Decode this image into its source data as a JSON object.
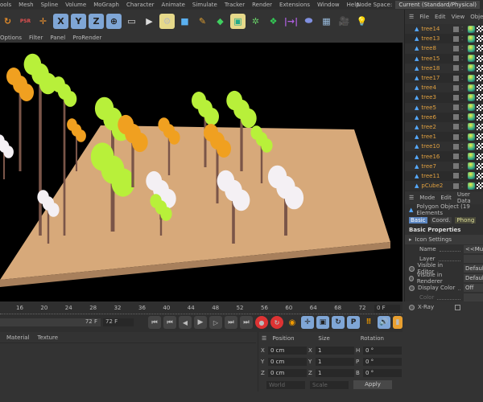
{
  "menu": [
    "ools",
    "Mesh",
    "Spline",
    "Volume",
    "MoGraph",
    "Character",
    "Animate",
    "Simulate",
    "Tracker",
    "Render",
    "Extensions",
    "Window",
    "Help"
  ],
  "node_space": {
    "label": "Node Space:",
    "value": "Current (Standard/Physical)"
  },
  "viewport_menu": [
    "Options",
    "Filter",
    "Panel",
    "ProRender"
  ],
  "object_manager": {
    "menu": [
      "File",
      "Edit",
      "View",
      "Objec"
    ],
    "objects": [
      "tree14",
      "tree13",
      "tree8",
      "tree15",
      "tree18",
      "tree17",
      "tree4",
      "tree3",
      "tree5",
      "tree6",
      "tree2",
      "tree1",
      "tree10",
      "tree16",
      "tree7",
      "tree11",
      "pCube2"
    ]
  },
  "attributes": {
    "menu": [
      "Mode",
      "Edit",
      "User Data"
    ],
    "title": "Polygon Object (19 Elements",
    "tabs": [
      "Basic",
      "Coord.",
      "Phong"
    ],
    "section": "Basic Properties",
    "group": "Icon Settings",
    "name_label": "Name",
    "name_value": "<<Mul",
    "layer_label": "Layer",
    "vis_editor_label": "Visible in Editor",
    "vis_editor_value": "Defaul",
    "vis_render_label": "Visible in Renderer",
    "vis_render_value": "Defaul",
    "display_color_label": "Display Color",
    "display_color_value": "Off",
    "color_label": "Color",
    "xray_label": "X-Ray"
  },
  "timeline": {
    "ticks": [
      "16",
      "20",
      "24",
      "28",
      "32",
      "36",
      "40",
      "44",
      "48",
      "52",
      "56",
      "60",
      "64",
      "68",
      "72"
    ],
    "current_frame": "0 F",
    "end_frame": "72 F",
    "max_frame": "72 F"
  },
  "material_menu": [
    "Material",
    "Texture"
  ],
  "coordinates": {
    "headers": [
      "Position",
      "Size",
      "Rotation"
    ],
    "rows": [
      {
        "a": "X",
        "pos": "0 cm",
        "b": "X",
        "size": "1",
        "c": "H",
        "rot": "0 °"
      },
      {
        "a": "Y",
        "pos": "0 cm",
        "b": "Y",
        "size": "1",
        "c": "P",
        "rot": "0 °"
      },
      {
        "a": "Z",
        "pos": "0 cm",
        "b": "Z",
        "size": "1",
        "c": "B",
        "rot": "0 °"
      }
    ],
    "mode": "World",
    "size_mode": "Scale",
    "apply": "Apply"
  },
  "colors": {
    "ground": "#d7a97a",
    "leaf_green": "#b8f03a",
    "leaf_orange": "#f0a020",
    "leaf_white": "#f4f0f4",
    "trunk": "#7a5548"
  }
}
